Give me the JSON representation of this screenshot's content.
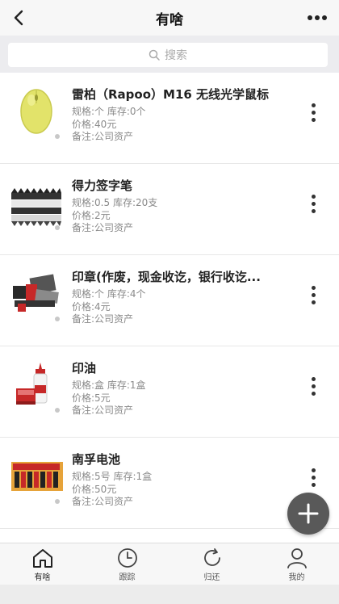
{
  "header": {
    "title": "有啥",
    "back_icon": "chevron-left-icon",
    "more_icon": "more-horizontal-icon"
  },
  "search": {
    "placeholder": "搜索",
    "icon": "search-icon"
  },
  "items": [
    {
      "name": "雷柏（Rapoo）M16 无线光学鼠标",
      "spec": "规格:个 库存:0个",
      "price": "价格:40元",
      "note": "备注:公司资产",
      "thumb": "mouse-image"
    },
    {
      "name": "得力签字笔",
      "spec": "规格:0.5 库存:20支",
      "price": "价格:2元",
      "note": "备注:公司资产",
      "thumb": "pens-image"
    },
    {
      "name": "印章(作废，现金收讫，银行收讫...",
      "spec": "规格:个 库存:4个",
      "price": "价格:4元",
      "note": "备注:公司资产",
      "thumb": "stamps-image"
    },
    {
      "name": "印油",
      "spec": "规格:盒 库存:1盒",
      "price": "价格:5元",
      "note": "备注:公司资产",
      "thumb": "ink-image"
    },
    {
      "name": "南孚电池",
      "spec": "规格:5号 库存:1盒",
      "price": "价格:50元",
      "note": "备注:公司资产",
      "thumb": "battery-image"
    }
  ],
  "fab": {
    "icon": "plus-icon"
  },
  "tabs": [
    {
      "label": "有啥",
      "icon": "home-icon",
      "active": true
    },
    {
      "label": "跟踪",
      "icon": "clock-icon",
      "active": false
    },
    {
      "label": "归还",
      "icon": "refresh-icon",
      "active": false
    },
    {
      "label": "我的",
      "icon": "user-icon",
      "active": false
    }
  ],
  "colors": {
    "text_primary": "#222222",
    "text_secondary": "#8a8a8a",
    "fab": "#595959",
    "mouse_yellow": "#e2e36a"
  }
}
